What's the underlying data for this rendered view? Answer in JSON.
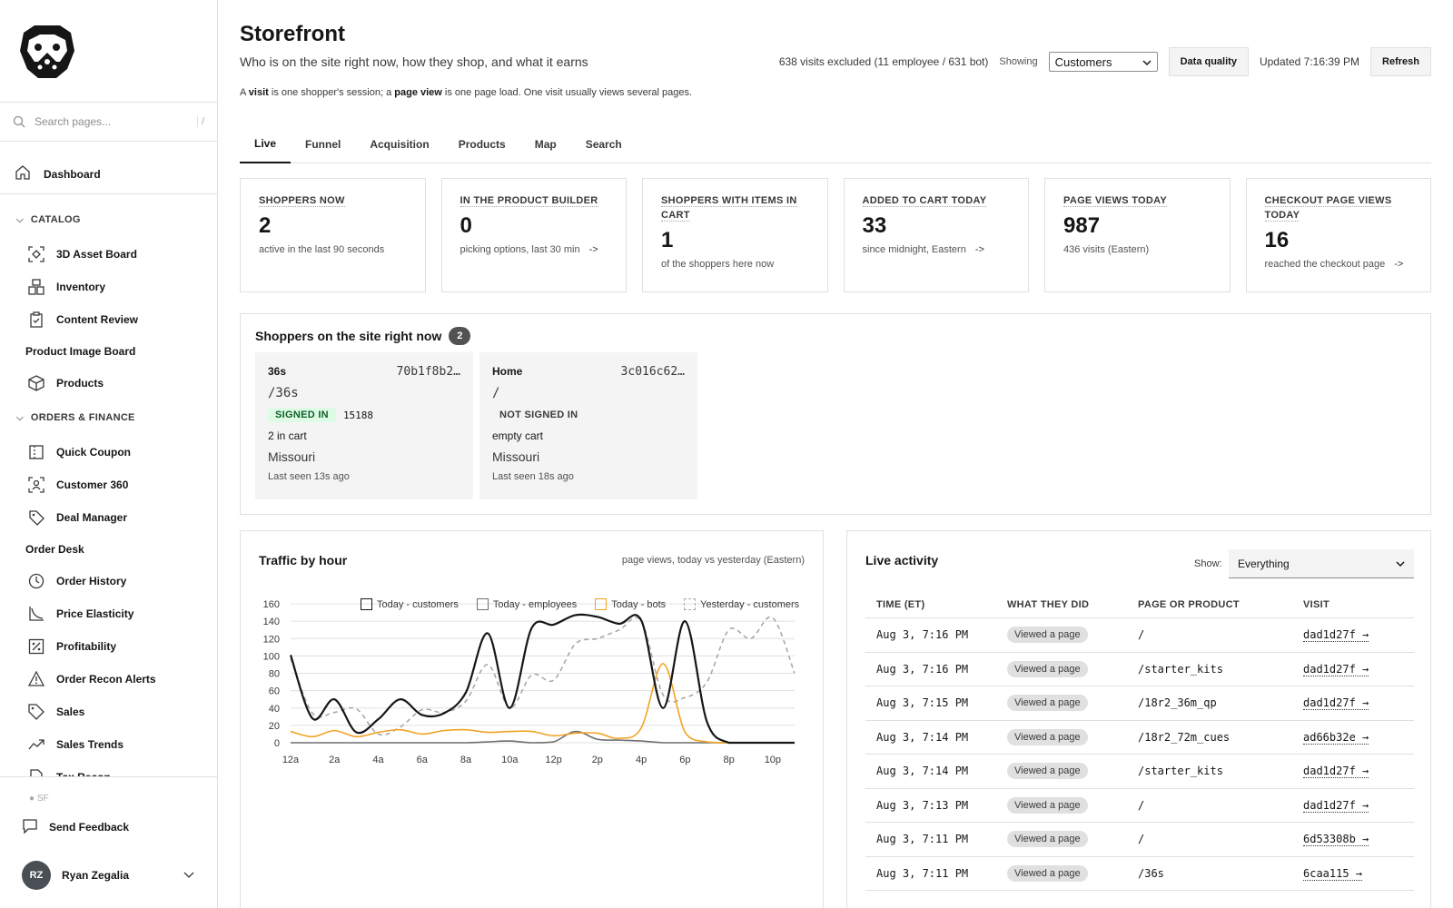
{
  "sidebar": {
    "search_placeholder": "Search pages...",
    "search_shortcut": "/",
    "dashboard": "Dashboard",
    "groups": [
      {
        "label": "CATALOG"
      },
      {
        "label": "ORDERS & FINANCE"
      }
    ],
    "catalog_items": [
      "3D Asset Board",
      "Inventory",
      "Content Review"
    ],
    "catalog_plain": "Product Image Board",
    "catalog_products": "Products",
    "finance_items_a": [
      "Quick Coupon",
      "Customer 360",
      "Deal Manager"
    ],
    "finance_plain": "Order Desk",
    "finance_items_b": [
      "Order History",
      "Price Elasticity",
      "Profitability",
      "Order Recon Alerts",
      "Sales",
      "Sales Trends",
      "Tax Recon"
    ],
    "sf": "SF",
    "feedback": "Send Feedback",
    "user_initials": "RZ",
    "user_name": "Ryan Zegalia"
  },
  "header": {
    "title": "Storefront",
    "subtitle": "Who is on the site right now, how they shop, and what it earns",
    "explain_a": "A ",
    "explain_visit": "visit",
    "explain_b": " is one shopper's session; a ",
    "explain_pv": "page view",
    "explain_c": " is one page load. One visit usually views several pages.",
    "excluded": "638 visits excluded (11 employee / 631 bot)",
    "showing": "Showing",
    "showing_value": "Customers",
    "data_quality": "Data quality",
    "updated": "Updated 7:16:39 PM",
    "refresh": "Refresh"
  },
  "tabs": [
    "Live",
    "Funnel",
    "Acquisition",
    "Products",
    "Map",
    "Search"
  ],
  "kpis": [
    {
      "label": "SHOPPERS NOW",
      "value": "2",
      "note": "active in the last 90 seconds",
      "arrow": ""
    },
    {
      "label": "IN THE PRODUCT BUILDER",
      "value": "0",
      "note": "picking options, last 30 min",
      "arrow": "->"
    },
    {
      "label": "SHOPPERS WITH ITEMS IN CART",
      "value": "1",
      "note": "of the shoppers here now",
      "arrow": ""
    },
    {
      "label": "ADDED TO CART TODAY",
      "value": "33",
      "note": "since midnight, Eastern",
      "arrow": "->"
    },
    {
      "label": "PAGE VIEWS TODAY",
      "value": "987",
      "note": "436 visits (Eastern)",
      "arrow": ""
    },
    {
      "label": "CHECKOUT PAGE VIEWS TODAY",
      "value": "16",
      "note": "reached the checkout page",
      "arrow": "->"
    }
  ],
  "shoppers": {
    "title": "Shoppers on the site right now",
    "count": "2",
    "cards": [
      {
        "page": "36s",
        "id": "70b1f8b2…",
        "path": "/36s",
        "signed": "SIGNED IN",
        "user_id": "15188",
        "cart": "2 in cart",
        "state": "Missouri",
        "seen": "Last seen 13s ago"
      },
      {
        "page": "Home",
        "id": "3c016c62…",
        "path": "/",
        "signed": "NOT SIGNED IN",
        "user_id": "",
        "cart": "empty cart",
        "state": "Missouri",
        "seen": "Last seen 18s ago"
      }
    ]
  },
  "traffic": {
    "title": "Traffic by hour",
    "subtitle": "page views, today vs yesterday (Eastern)"
  },
  "chart_data": {
    "type": "line",
    "x": [
      "12a",
      "1a",
      "2a",
      "3a",
      "4a",
      "5a",
      "6a",
      "7a",
      "8a",
      "9a",
      "10a",
      "11a",
      "12p",
      "1p",
      "2p",
      "3p",
      "4p",
      "5p",
      "6p",
      "7p",
      "8p",
      "9p",
      "10p",
      "11p"
    ],
    "tick_labels": [
      "12a",
      "2a",
      "4a",
      "6a",
      "8a",
      "10a",
      "12p",
      "2p",
      "4p",
      "6p",
      "8p",
      "10p"
    ],
    "ylim": [
      0,
      160
    ],
    "yticks": [
      0,
      20,
      40,
      60,
      80,
      100,
      120,
      140,
      160
    ],
    "grid": true,
    "legend_position": "top",
    "series": [
      {
        "name": "Today - customers",
        "color": "#161616",
        "dash": false,
        "values": [
          101,
          28,
          50,
          12,
          27,
          50,
          32,
          34,
          58,
          126,
          40,
          132,
          136,
          147,
          145,
          137,
          141,
          40,
          140,
          24,
          0,
          0,
          0,
          0
        ]
      },
      {
        "name": "Today - employees",
        "color": "#6f6f6f",
        "dash": false,
        "values": [
          0,
          0,
          0,
          0,
          0,
          0,
          0,
          0,
          0,
          1,
          2,
          0,
          1,
          13,
          4,
          3,
          2,
          0,
          0,
          0,
          0,
          0,
          0,
          0
        ]
      },
      {
        "name": "Today - bots",
        "color": "#f1a325",
        "dash": false,
        "values": [
          13,
          7,
          14,
          7,
          12,
          15,
          10,
          14,
          15,
          12,
          13,
          13,
          8,
          11,
          11,
          5,
          17,
          91,
          12,
          1,
          0,
          0,
          0,
          0
        ]
      },
      {
        "name": "Yesterday - customers",
        "color": "#a8a8a8",
        "dash": true,
        "values": [
          97,
          34,
          35,
          39,
          10,
          18,
          38,
          35,
          48,
          90,
          40,
          78,
          72,
          114,
          120,
          130,
          140,
          55,
          52,
          70,
          130,
          120,
          144,
          80
        ]
      }
    ]
  },
  "activity": {
    "title": "Live activity",
    "show_label": "Show:",
    "show_value": "Everything",
    "headers": [
      "TIME (ET)",
      "WHAT THEY DID",
      "PAGE OR PRODUCT",
      "VISIT"
    ],
    "rows": [
      {
        "time": "Aug 3, 7:16 PM",
        "action": "Viewed a page",
        "page": "/",
        "visit": "dad1d27f →"
      },
      {
        "time": "Aug 3, 7:16 PM",
        "action": "Viewed a page",
        "page": "/starter_kits",
        "visit": "dad1d27f →"
      },
      {
        "time": "Aug 3, 7:15 PM",
        "action": "Viewed a page",
        "page": "/18r2_36m_qp",
        "visit": "dad1d27f →"
      },
      {
        "time": "Aug 3, 7:14 PM",
        "action": "Viewed a page",
        "page": "/18r2_72m_cues",
        "visit": "ad66b32e →"
      },
      {
        "time": "Aug 3, 7:14 PM",
        "action": "Viewed a page",
        "page": "/starter_kits",
        "visit": "dad1d27f →"
      },
      {
        "time": "Aug 3, 7:13 PM",
        "action": "Viewed a page",
        "page": "/",
        "visit": "dad1d27f →"
      },
      {
        "time": "Aug 3, 7:11 PM",
        "action": "Viewed a page",
        "page": "/",
        "visit": "6d53308b →"
      },
      {
        "time": "Aug 3, 7:11 PM",
        "action": "Viewed a page",
        "page": "/36s",
        "visit": "6caa115 →"
      }
    ]
  }
}
